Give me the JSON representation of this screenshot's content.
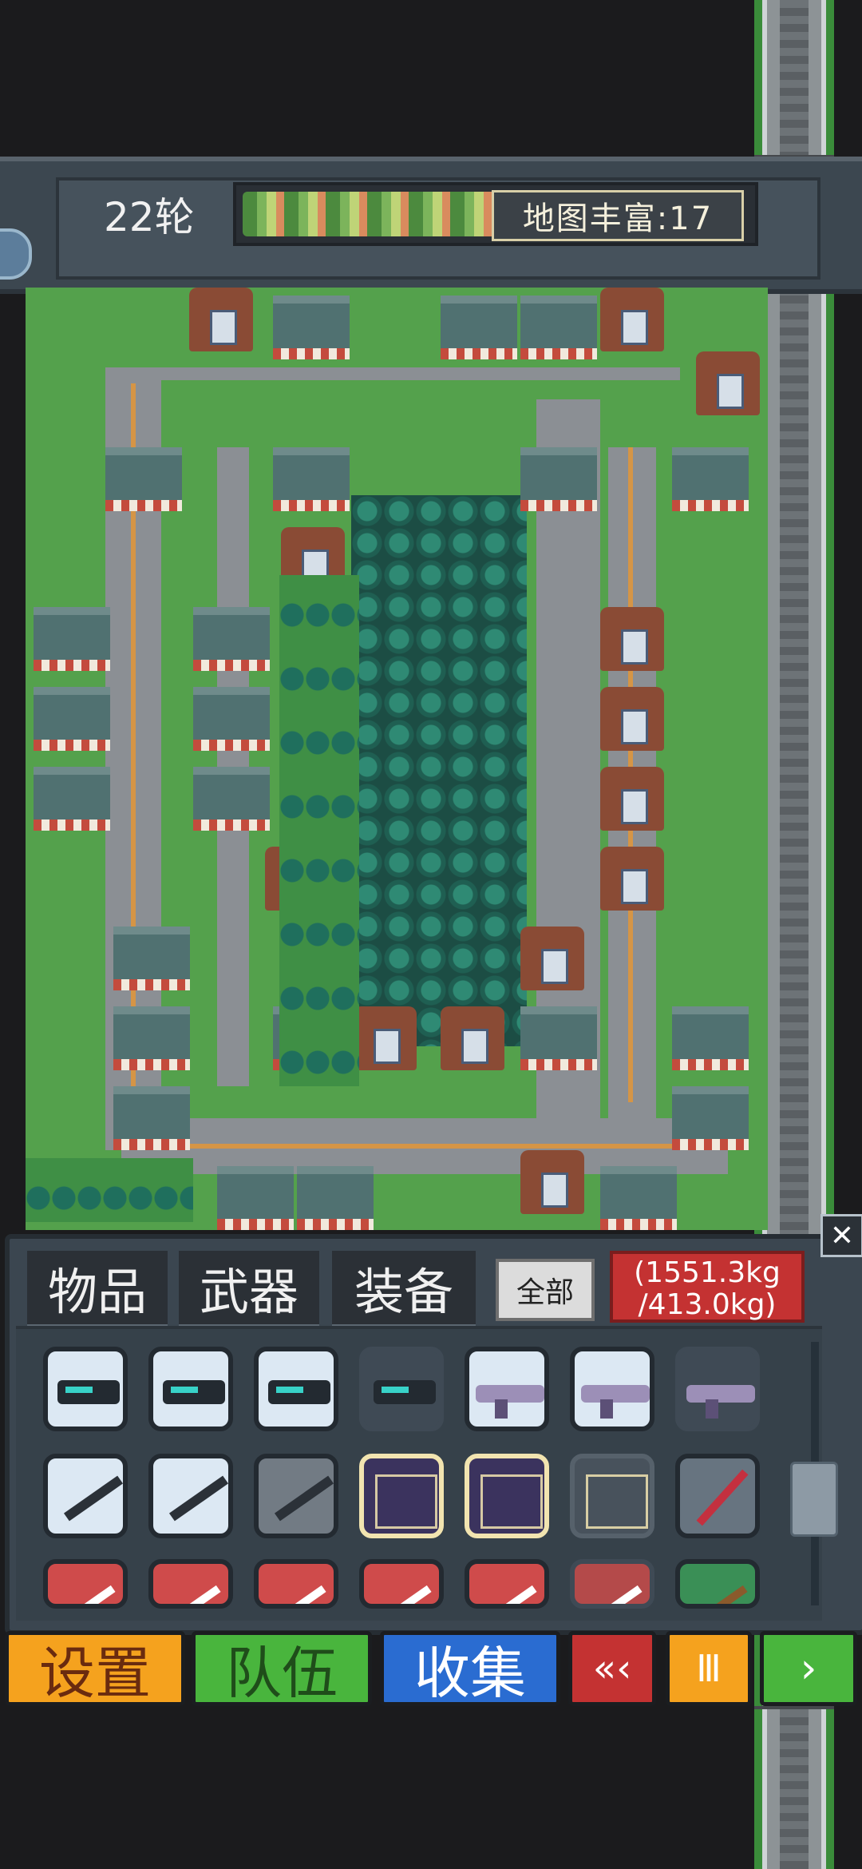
{
  "hud": {
    "round": "22轮",
    "map_richness": "地图丰富:17"
  },
  "inventory": {
    "tabs": [
      "物品",
      "武器",
      "装备"
    ],
    "filter_all": "全部",
    "weight_line1": "(1551.3kg",
    "weight_line2": "/413.0kg)",
    "close_symbol": "✕",
    "items": [
      [
        "gun-icon",
        "gun-icon",
        "gun-icon",
        "gun-icon",
        "rifle-icon",
        "rifle-icon",
        "rifle-icon"
      ],
      [
        "blade-icon",
        "blade-icon",
        "blade-icon",
        "chip-icon",
        "chip-icon",
        "chip-icon",
        "red-saber-icon"
      ],
      [
        "dagger-icon",
        "dagger-icon",
        "dagger-icon",
        "dagger-icon",
        "dagger-icon",
        "dagger-icon",
        "spear-icon"
      ]
    ]
  },
  "buttons": {
    "settings": "设置",
    "team": "队伍",
    "collect": "收集",
    "back": "«‹",
    "pause": "Ⅲ",
    "next": "›"
  }
}
